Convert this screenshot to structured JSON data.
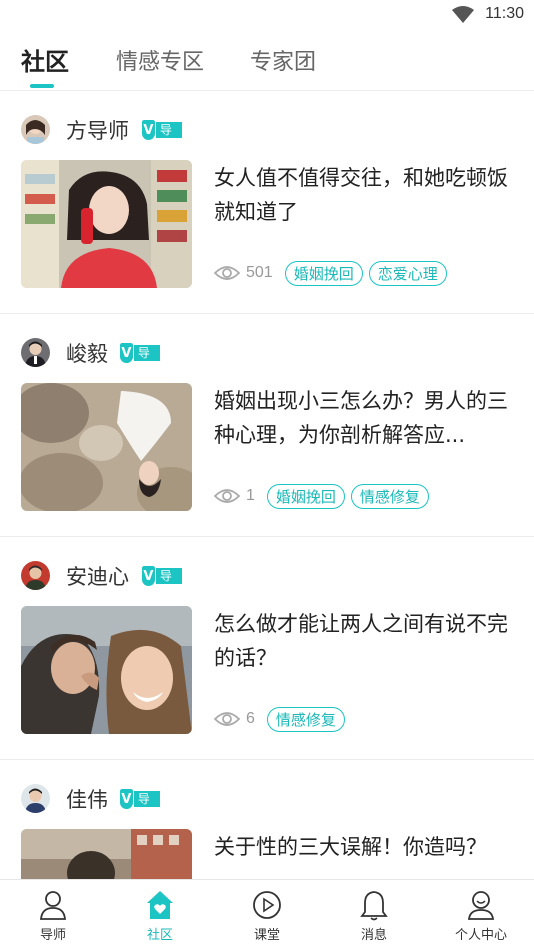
{
  "status_bar": {
    "time": "11:30"
  },
  "tabs": [
    {
      "label": "社区",
      "active": true
    },
    {
      "label": "情感专区",
      "active": false
    },
    {
      "label": "专家团",
      "active": false
    }
  ],
  "badge_label": "导师",
  "posts": [
    {
      "author": "方导师",
      "title": "女人值不值得交往，和她吃顿饭就知道了",
      "views": "501",
      "tags": [
        "婚姻挽回",
        "恋爱心理"
      ]
    },
    {
      "author": "峻毅",
      "title": "婚姻出现小三怎么办？男人的三种心理，为你剖析解答应...",
      "views": "1",
      "tags": [
        "婚姻挽回",
        "情感修复"
      ]
    },
    {
      "author": "安迪心",
      "title": "怎么做才能让两人之间有说不完的话？",
      "views": "6",
      "tags": [
        "情感修复"
      ]
    },
    {
      "author": "佳伟",
      "title": "关于性的三大误解！你造吗？",
      "views": "",
      "tags": []
    }
  ],
  "bottom_nav": [
    {
      "label": "导师",
      "icon": "person-icon",
      "active": false
    },
    {
      "label": "社区",
      "icon": "home-heart-icon",
      "active": true
    },
    {
      "label": "课堂",
      "icon": "play-circle-icon",
      "active": false
    },
    {
      "label": "消息",
      "icon": "bell-icon",
      "active": false
    },
    {
      "label": "个人中心",
      "icon": "profile-icon",
      "active": false
    }
  ],
  "colors": {
    "accent": "#1cc4c4"
  }
}
